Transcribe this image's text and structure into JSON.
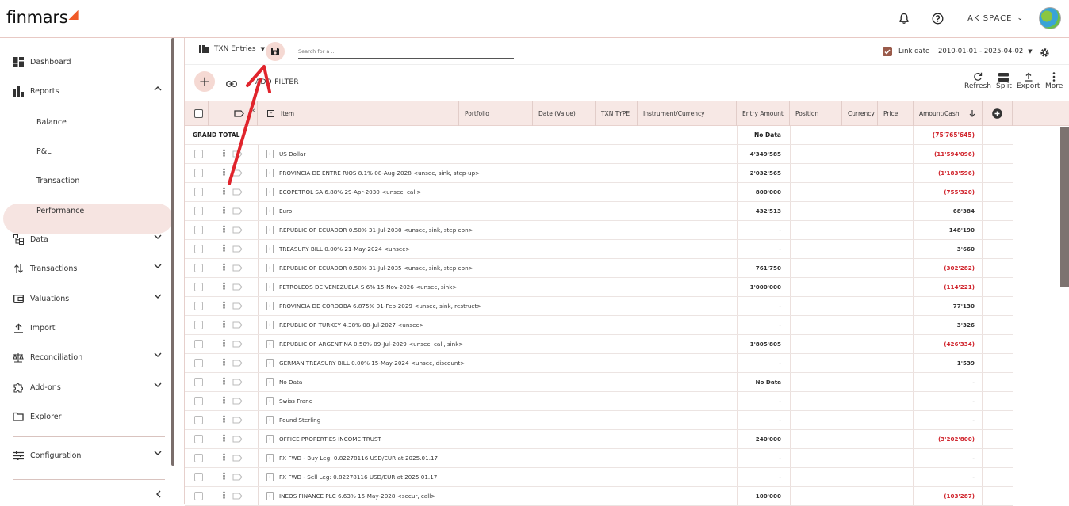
{
  "header": {
    "logo_text": "finmars",
    "space_label": "AK SPACE",
    "colors": {
      "brand": "#f05a28",
      "accent_bg": "#f5d9d3",
      "negative": "#d0242c"
    }
  },
  "sidebar": {
    "items": [
      {
        "label": "Dashboard",
        "icon": "dashboard-icon"
      },
      {
        "label": "Reports",
        "icon": "bar-chart-icon",
        "expanded": true
      },
      {
        "label": "Data",
        "icon": "data-icon"
      },
      {
        "label": "Transactions",
        "icon": "swap-icon"
      },
      {
        "label": "Valuations",
        "icon": "valuation-icon"
      },
      {
        "label": "Import",
        "icon": "upload-icon"
      },
      {
        "label": "Reconciliation",
        "icon": "scale-icon"
      },
      {
        "label": "Add-ons",
        "icon": "puzzle-icon"
      },
      {
        "label": "Explorer",
        "icon": "folder-icon"
      },
      {
        "label": "Configuration",
        "icon": "tune-icon"
      }
    ],
    "report_subitems": [
      "Balance",
      "P&L",
      "Transaction",
      "Performance"
    ],
    "active_subitem": "Transaction"
  },
  "toolbar": {
    "layout_name": "TXN Entries",
    "search_placeholder": "Search for a ...",
    "link_date_label": "Link date",
    "link_date_checked": true,
    "date_range": "2010-01-01 - 2025-04-02",
    "add_filter_label": "ADD FILTER",
    "actions": [
      "Refresh",
      "Split",
      "Export",
      "More"
    ]
  },
  "table": {
    "columns": [
      "Item",
      "Portfolio",
      "Date (Value)",
      "TXN TYPE",
      "Instrument/Currency",
      "Entry Amount",
      "Position",
      "Currency",
      "Price",
      "Amount/Cash"
    ],
    "grand_total": {
      "label": "GRAND TOTAL",
      "entry_amount": "No Data",
      "amount_cash": "(75'765'645)"
    },
    "rows": [
      {
        "item": "US Dollar",
        "entry_amount": "4'349'585",
        "amount_cash": "(11'594'096)",
        "neg": true
      },
      {
        "item": "PROVINCIA DE ENTRE RIOS  8.1%  08-Aug-2028  <unsec, sink, step-up>",
        "entry_amount": "2'032'565",
        "amount_cash": "(1'183'596)",
        "neg": true
      },
      {
        "item": "ECOPETROL SA  6.88%  29-Apr-2030  <unsec, call>",
        "entry_amount": "800'000",
        "amount_cash": "(755'320)",
        "neg": true
      },
      {
        "item": "Euro",
        "entry_amount": "432'513",
        "amount_cash": "68'384",
        "neg": false
      },
      {
        "item": "REPUBLIC OF ECUADOR  0.50%  31-Jul-2030  <unsec, sink, step cpn>",
        "entry_amount": "-",
        "amount_cash": "148'190",
        "neg": false
      },
      {
        "item": "TREASURY BILL  0.00%  21-May-2024  <unsec>",
        "entry_amount": "-",
        "amount_cash": "3'660",
        "neg": false
      },
      {
        "item": "REPUBLIC OF ECUADOR  0.50%  31-Jul-2035  <unsec, sink, step cpn>",
        "entry_amount": "761'750",
        "amount_cash": "(302'282)",
        "neg": true
      },
      {
        "item": "PETROLEOS DE VENEZUELA S  6%  15-Nov-2026  <unsec, sink>",
        "entry_amount": "1'000'000",
        "amount_cash": "(114'221)",
        "neg": true
      },
      {
        "item": "PROVINCIA DE CORDOBA  6.875%  01-Feb-2029  <unsec, sink, restruct>",
        "entry_amount": "-",
        "amount_cash": "77'130",
        "neg": false
      },
      {
        "item": "REPUBLIC OF TURKEY  4.38%  08-Jul-2027  <unsec>",
        "entry_amount": "-",
        "amount_cash": "3'326",
        "neg": false
      },
      {
        "item": "REPUBLIC OF ARGENTINA  0.50%  09-Jul-2029  <unsec, call, sink>",
        "entry_amount": "1'805'805",
        "amount_cash": "(426'334)",
        "neg": true
      },
      {
        "item": "GERMAN TREASURY BILL  0.00%  15-May-2024  <unsec, discount>",
        "entry_amount": "-",
        "amount_cash": "1'539",
        "neg": false
      },
      {
        "item": "No Data",
        "entry_amount": "No Data",
        "amount_cash": "-",
        "neg": false
      },
      {
        "item": "Swiss Franc",
        "entry_amount": "-",
        "amount_cash": "-",
        "neg": false
      },
      {
        "item": "Pound Sterling",
        "entry_amount": "-",
        "amount_cash": "-",
        "neg": false
      },
      {
        "item": "OFFICE PROPERTIES INCOME TRUST",
        "entry_amount": "240'000",
        "amount_cash": "(3'202'800)",
        "neg": true
      },
      {
        "item": "FX FWD - Buy Leg: 0.82278116 USD/EUR at 2025.01.17",
        "entry_amount": "-",
        "amount_cash": "-",
        "neg": false
      },
      {
        "item": "FX FWD - Sell Leg: 0.82278116 USD/EUR at 2025.01.17",
        "entry_amount": "-",
        "amount_cash": "-",
        "neg": false
      },
      {
        "item": "INEOS FINANCE PLC  6.63%  15-May-2028  <secur, call>",
        "entry_amount": "100'000",
        "amount_cash": "(103'287)",
        "neg": true
      }
    ]
  }
}
